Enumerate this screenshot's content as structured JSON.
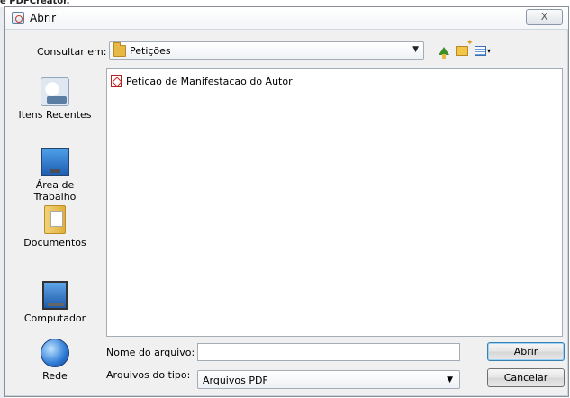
{
  "background_app": {
    "title": "e PDFCreator."
  },
  "dialog": {
    "title": "Abrir",
    "close_label": "X"
  },
  "lookin": {
    "label": "Consultar em:",
    "current_folder": "Petições",
    "folder_icon": "folder-icon",
    "toolbar": {
      "up_icon": "up-one-level-icon",
      "new_folder_icon": "new-folder-icon",
      "view_menu_icon": "view-menu-icon"
    }
  },
  "places": [
    {
      "label": "Itens Recentes",
      "icon": "recent-items-icon"
    },
    {
      "label": "Área de\nTrabalho",
      "icon": "desktop-icon"
    },
    {
      "label": "Documentos",
      "icon": "documents-icon"
    },
    {
      "label": "Computador",
      "icon": "computer-icon"
    },
    {
      "label": "Rede",
      "icon": "network-icon"
    }
  ],
  "files": [
    {
      "name": "Peticao de Manifestacao do Autor",
      "icon": "pdf-file-icon"
    }
  ],
  "filename": {
    "label": "Nome do arquivo:",
    "value": ""
  },
  "filetype": {
    "label": "Arquivos do tipo:",
    "selected": "Arquivos PDF"
  },
  "buttons": {
    "open": "Abrir",
    "cancel": "Cancelar"
  }
}
